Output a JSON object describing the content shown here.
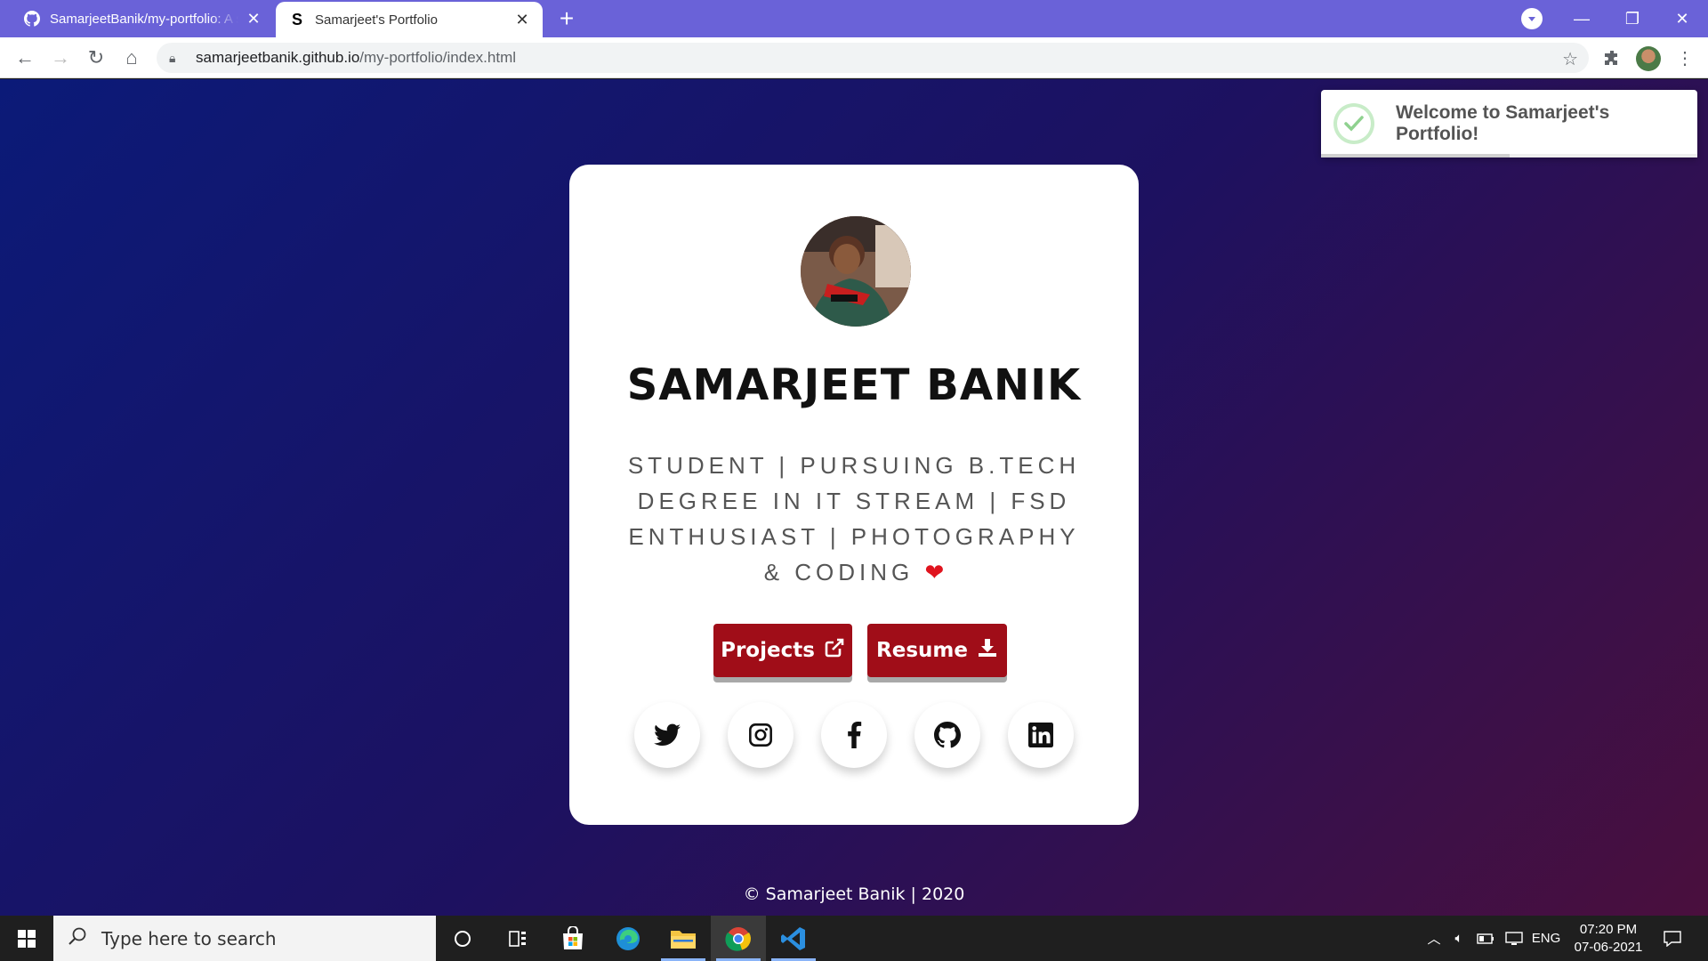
{
  "browser": {
    "tabs": [
      {
        "title": "SamarjeetBanik/my-portfolio: A s",
        "active": false
      },
      {
        "title": "Samarjeet's Portfolio",
        "active": true,
        "favicon_letter": "S"
      }
    ],
    "url_host": "samarjeetbanik.github.io",
    "url_path": "/my-portfolio/index.html"
  },
  "toast": {
    "message": "Welcome to Samarjeet's Portfolio!",
    "progress": 0.5
  },
  "card": {
    "name": "SAMARJEET BANIK",
    "bio": "STUDENT | PURSUING B.TECH DEGREE IN IT STREAM | FSD ENTHUSIAST | PHOTOGRAPHY & CODING",
    "buttons": {
      "projects": "Projects",
      "resume": "Resume"
    },
    "socials": [
      "twitter-icon",
      "instagram-icon",
      "facebook-icon",
      "github-icon",
      "linkedin-icon"
    ]
  },
  "footer": "© Samarjeet Banik | 2020",
  "taskbar": {
    "search_placeholder": "Type here to search",
    "language": "ENG",
    "time": "07:20 PM",
    "date": "07-06-2021"
  },
  "colors": {
    "tabstrip": "#6a62d8",
    "button": "#a00d18",
    "bg_start": "#0b1a78",
    "bg_end": "#4a0f3d"
  }
}
